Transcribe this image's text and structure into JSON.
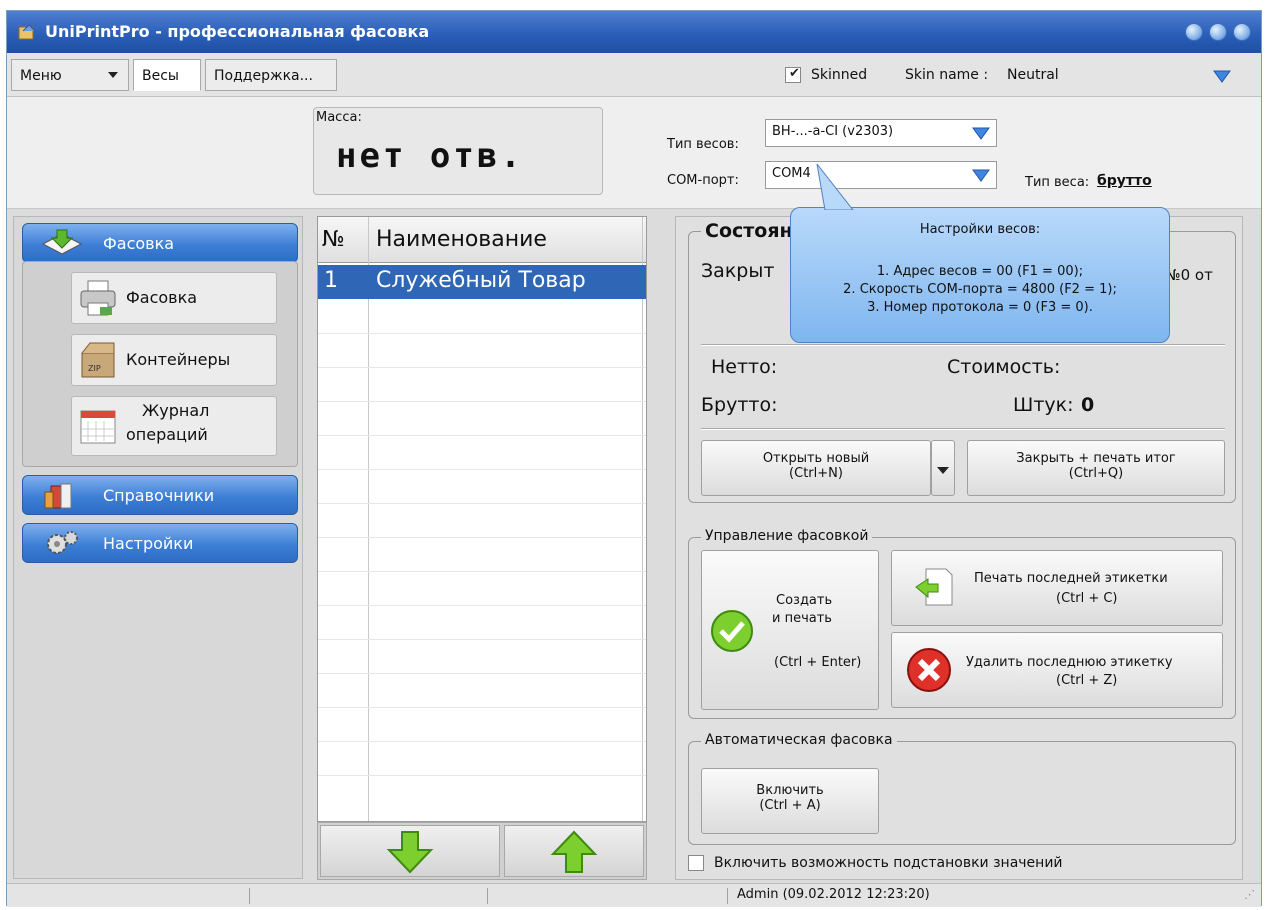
{
  "window": {
    "title": "UniPrintPro - профессиональная фасовка"
  },
  "menubar": {
    "menu_label": "Меню",
    "tabs": [
      {
        "label": "Весы",
        "active": true
      },
      {
        "label": "Поддержка...",
        "active": false
      }
    ],
    "skinned_label": "Skinned",
    "skinned_checked": true,
    "skin_name_label": "Skin name :",
    "skin_name_value": "Neutral"
  },
  "scale": {
    "mass_label": "Масса:",
    "mass_value": "нет отв.",
    "scale_type_label": "Тип весов:",
    "scale_type_value": "ВН-...-a-CI (v2303)",
    "com_port_label": "COM-порт:",
    "com_port_value": "COM4",
    "weight_type_label": "Тип веса:",
    "weight_type_value": "брутто"
  },
  "nav": {
    "sections": [
      {
        "label": "Фасовка",
        "expanded": true,
        "items": [
          "Фасовка",
          "Контейнеры",
          "Журнал операций"
        ]
      },
      {
        "label": "Справочники",
        "expanded": false
      },
      {
        "label": "Настройки",
        "expanded": false
      }
    ],
    "item_journal_line1": "Журнал",
    "item_journal_line2": "операций"
  },
  "product_list": {
    "col_num": "№",
    "col_name": "Наименование",
    "rows": [
      {
        "num": "1",
        "name": "Служебный Товар",
        "selected": true
      }
    ]
  },
  "container_state": {
    "title": "Состояние контейнера",
    "status": "Закрыт",
    "number": "№0 от",
    "netto_label": "Нетто:",
    "cost_label": "Стоимость:",
    "brutto_label": "Брутто:",
    "pieces_label": "Штук:",
    "pieces_value": "0",
    "open_new_line1": "Открыть новый",
    "open_new_line2": "(Ctrl+N)",
    "close_print_line1": "Закрыть + печать итог",
    "close_print_line2": "(Ctrl+Q)"
  },
  "packing_control": {
    "title": "Управление фасовкой",
    "create_line1": "Создать",
    "create_line2": "и печать",
    "create_shortcut": "(Ctrl + Enter)",
    "print_last_line1": "Печать последней этикетки",
    "print_last_line2": "(Ctrl + C)",
    "delete_last_line1": "Удалить последнюю этикетку",
    "delete_last_line2": "(Ctrl + Z)"
  },
  "auto_packing": {
    "title": "Автоматическая фасовка",
    "enable_line1": "Включить",
    "enable_line2": "(Ctrl + A)",
    "substitution_label": "Включить возможность подстановки значений",
    "substitution_checked": false
  },
  "tooltip": {
    "title": "Настройки весов:",
    "line1": "1. Адрес весов = 00 (F1 = 00);",
    "line2": "2. Скорость COM-порта = 4800 (F2 = 1);",
    "line3": "3. Номер протокола = 0 (F3 = 0)."
  },
  "statusbar": {
    "user_info": "Admin (09.02.2012 12:23:20)"
  },
  "colors": {
    "title_bar": "#2b5fb8",
    "nav_button": "#3e7fd6",
    "selection": "#2f66b5",
    "tooltip": "#9cc7f5"
  }
}
